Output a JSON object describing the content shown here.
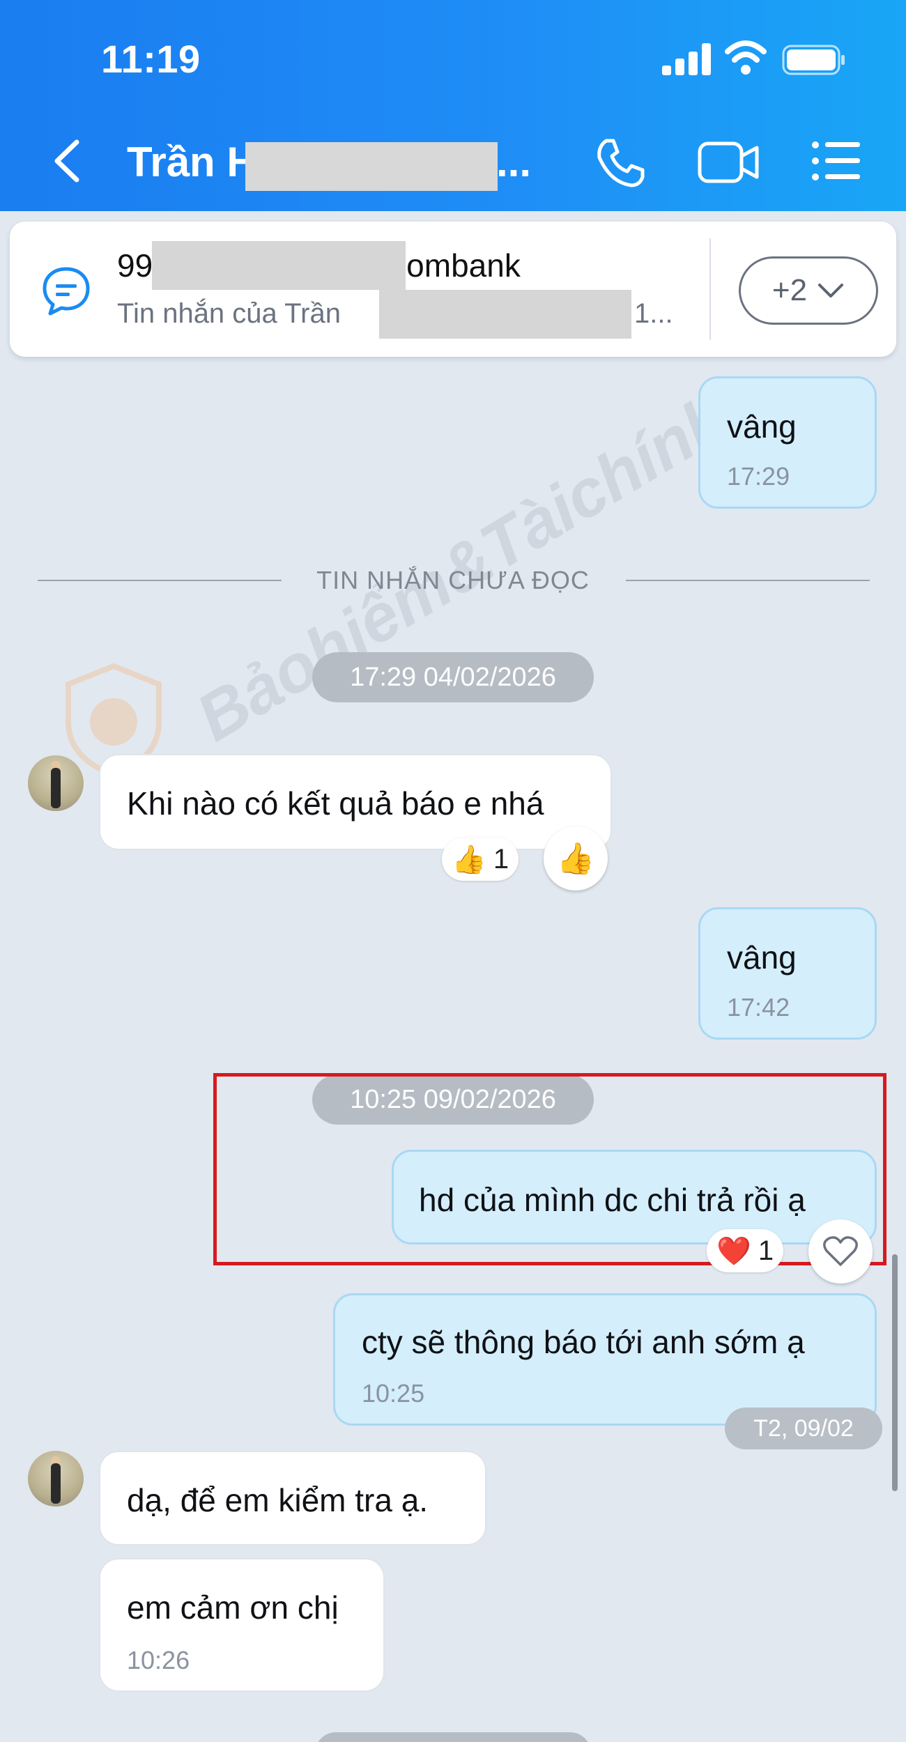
{
  "status_bar": {
    "time": "11:19"
  },
  "header": {
    "title_visible": "Trần H",
    "title_tail": "..."
  },
  "pinned": {
    "title_prefix": "99",
    "title_suffix": "ombank",
    "subtitle_prefix": "Tin nhắn của Trần",
    "subtitle_suffix": "1...",
    "more_label": "+2"
  },
  "watermark": "Bảohiểm&Tàichính",
  "messages": [
    {
      "dir": "out",
      "text": "vâng",
      "time": "17:29"
    },
    {
      "divider": "TIN NHẮN CHƯA ĐỌC"
    },
    {
      "date_pill": "17:29 04/02/2026"
    },
    {
      "dir": "in",
      "text": "Khi nào có kết quả báo e nhá",
      "reaction": {
        "emoji": "👍",
        "count": "1"
      }
    },
    {
      "dir": "out",
      "text": "vâng",
      "time": "17:42"
    },
    {
      "date_pill": "10:25 09/02/2026"
    },
    {
      "dir": "out",
      "text": "hd của mình dc chi trả rồi ạ",
      "reaction": {
        "emoji": "❤️",
        "count": "1"
      }
    },
    {
      "dir": "out",
      "text": "cty sẽ thông báo tới anh sớm ạ",
      "time": "10:25"
    },
    {
      "day_chip": "T2, 09/02"
    },
    {
      "dir": "in",
      "text": "dạ, để em kiểm tra ạ."
    },
    {
      "dir": "in",
      "text": "em cảm ơn chị",
      "time": "10:26"
    }
  ],
  "colors": {
    "header_blue": "#1f8df6",
    "outgoing_bubble": "#d4eefc",
    "chat_background": "#e2e8f0",
    "highlight_red": "#d7191f"
  }
}
